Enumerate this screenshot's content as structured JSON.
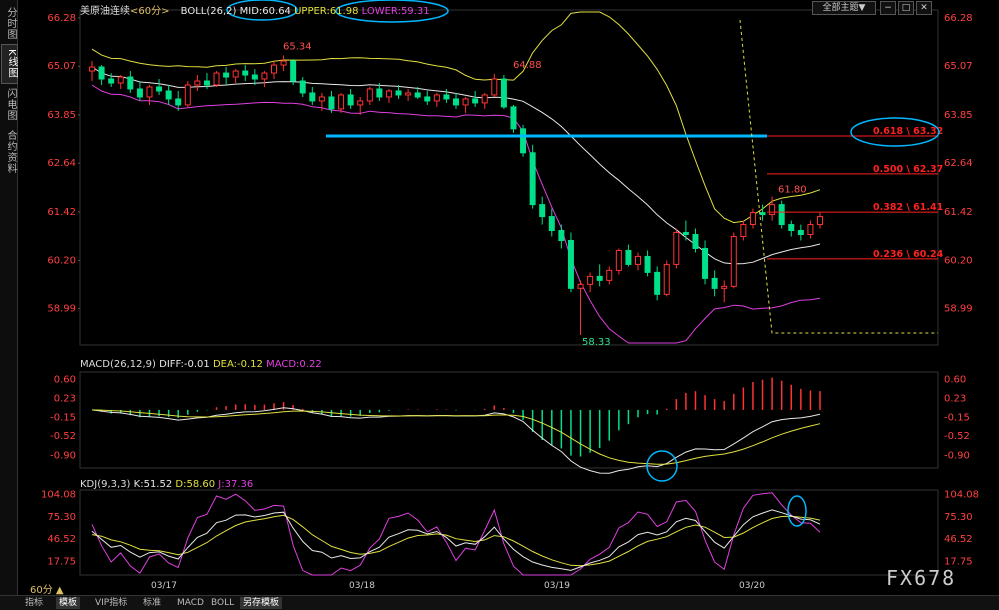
{
  "left_tabs": [
    "分时图",
    "K线图",
    "闪电图",
    "合约资料"
  ],
  "left_tab_active": 1,
  "top_right": {
    "theme_button": "全部主题▼",
    "icons": [
      "−",
      "□",
      "✕"
    ]
  },
  "boll_legend": {
    "symbol": "美原油连续",
    "period": "<60分>",
    "indicator": "BOLL(26,2)",
    "mid": "MID:60.64",
    "upper": "UPPER:61.98",
    "lower": "LOWER:59.31"
  },
  "macd_legend": {
    "name": "MACD(26,12,9)",
    "diff": "DIFF:-0.01",
    "dea": "DEA:-0.12",
    "macd": "MACD:0.22"
  },
  "kdj_legend": {
    "name": "KDJ(9,3,3)",
    "k": "K:51.52",
    "d": "D:58.60",
    "j": "J:37.36"
  },
  "price_axis": [
    "66.28",
    "65.07",
    "63.85",
    "62.64",
    "61.42",
    "60.20",
    "58.99"
  ],
  "macd_axis": [
    "0.60",
    "0.23",
    "-0.15",
    "-0.52",
    "-0.90"
  ],
  "kdj_axis": [
    "104.08",
    "75.30",
    "46.52",
    "17.75"
  ],
  "date_labels": [
    "03/17",
    "03/18",
    "03/19",
    "03/20"
  ],
  "price_annotations": {
    "high1": "65.34",
    "high2": "64.88",
    "low": "58.33",
    "recent_high": "61.80"
  },
  "fib_levels": [
    {
      "label": "0.618 \\ 63.32",
      "value": 63.32
    },
    {
      "label": "0.500 \\ 62.37",
      "value": 62.37
    },
    {
      "label": "0.382 \\ 61.41",
      "value": 61.41
    },
    {
      "label": "0.236 \\ 60.24",
      "value": 60.24
    }
  ],
  "support_line_value": 63.32,
  "period_label": "60分 ▲",
  "bottom_tabs": [
    "指标",
    "模板",
    "VIP指标",
    "标准",
    "MACD",
    "BOLL",
    "另存模板"
  ],
  "bottom_tab_active": [
    1,
    6
  ],
  "watermark": "FX678",
  "colors": {
    "up": "#ff3333",
    "down": "#00e08a",
    "mid": "#e8e8e8",
    "upper": "#e0e040",
    "lower": "#e040e0",
    "fib": "#ff2020",
    "support": "#00b8ff",
    "circle": "#00b8ff"
  },
  "chart_data": {
    "type": "candlestick",
    "candles_ohlc": [
      [
        64.95,
        65.2,
        64.7,
        65.05
      ],
      [
        65.05,
        65.1,
        64.6,
        64.75
      ],
      [
        64.75,
        64.9,
        64.55,
        64.65
      ],
      [
        64.65,
        64.85,
        64.5,
        64.8
      ],
      [
        64.8,
        64.95,
        64.4,
        64.5
      ],
      [
        64.5,
        64.7,
        64.2,
        64.3
      ],
      [
        64.3,
        64.6,
        64.1,
        64.55
      ],
      [
        64.55,
        64.75,
        64.35,
        64.45
      ],
      [
        64.45,
        64.6,
        64.1,
        64.25
      ],
      [
        64.25,
        64.45,
        63.95,
        64.1
      ],
      [
        64.1,
        64.7,
        64.05,
        64.6
      ],
      [
        64.6,
        64.85,
        64.45,
        64.7
      ],
      [
        64.7,
        64.9,
        64.5,
        64.6
      ],
      [
        64.6,
        64.95,
        64.55,
        64.9
      ],
      [
        64.9,
        65.05,
        64.6,
        64.8
      ],
      [
        64.8,
        65.0,
        64.65,
        64.95
      ],
      [
        64.95,
        65.1,
        64.7,
        64.85
      ],
      [
        64.85,
        65.0,
        64.6,
        64.75
      ],
      [
        64.75,
        64.95,
        64.55,
        64.9
      ],
      [
        64.9,
        65.2,
        64.75,
        65.1
      ],
      [
        65.1,
        65.34,
        64.95,
        65.2
      ],
      [
        65.2,
        65.25,
        64.6,
        64.7
      ],
      [
        64.7,
        64.8,
        64.3,
        64.4
      ],
      [
        64.4,
        64.55,
        64.1,
        64.2
      ],
      [
        64.2,
        64.4,
        63.95,
        64.3
      ],
      [
        64.3,
        64.45,
        63.9,
        64.0
      ],
      [
        64.0,
        64.4,
        63.9,
        64.35
      ],
      [
        64.35,
        64.5,
        64.0,
        64.1
      ],
      [
        64.1,
        64.3,
        63.85,
        64.2
      ],
      [
        64.2,
        64.55,
        64.1,
        64.5
      ],
      [
        64.5,
        64.65,
        64.2,
        64.3
      ],
      [
        64.3,
        64.5,
        64.15,
        64.45
      ],
      [
        64.45,
        64.6,
        64.25,
        64.35
      ],
      [
        64.35,
        64.5,
        64.2,
        64.4
      ],
      [
        64.4,
        64.55,
        64.25,
        64.3
      ],
      [
        64.3,
        64.45,
        64.1,
        64.2
      ],
      [
        64.2,
        64.4,
        64.05,
        64.35
      ],
      [
        64.35,
        64.5,
        64.15,
        64.25
      ],
      [
        64.25,
        64.4,
        64.0,
        64.1
      ],
      [
        64.1,
        64.3,
        63.9,
        64.25
      ],
      [
        64.25,
        64.45,
        64.05,
        64.15
      ],
      [
        64.15,
        64.4,
        64.0,
        64.35
      ],
      [
        64.35,
        64.88,
        64.3,
        64.75
      ],
      [
        64.75,
        64.85,
        64.0,
        64.05
      ],
      [
        64.05,
        64.1,
        63.4,
        63.5
      ],
      [
        63.5,
        63.6,
        62.8,
        62.9
      ],
      [
        62.9,
        63.1,
        61.5,
        61.6
      ],
      [
        61.6,
        61.8,
        61.1,
        61.3
      ],
      [
        61.3,
        61.5,
        60.8,
        60.95
      ],
      [
        60.95,
        61.1,
        60.5,
        60.7
      ],
      [
        60.7,
        60.9,
        59.4,
        59.5
      ],
      [
        59.5,
        59.7,
        58.33,
        59.6
      ],
      [
        59.6,
        59.9,
        59.4,
        59.8
      ],
      [
        59.8,
        60.1,
        59.55,
        59.7
      ],
      [
        59.7,
        60.05,
        59.6,
        59.95
      ],
      [
        59.95,
        60.5,
        59.85,
        60.45
      ],
      [
        60.45,
        60.6,
        60.05,
        60.1
      ],
      [
        60.1,
        60.4,
        59.95,
        60.3
      ],
      [
        60.3,
        60.45,
        59.8,
        59.9
      ],
      [
        59.9,
        60.05,
        59.2,
        59.35
      ],
      [
        59.35,
        60.2,
        59.3,
        60.1
      ],
      [
        60.1,
        61.0,
        60.0,
        60.9
      ],
      [
        60.9,
        61.2,
        60.7,
        60.85
      ],
      [
        60.85,
        61.0,
        60.4,
        60.5
      ],
      [
        60.5,
        60.7,
        59.6,
        59.75
      ],
      [
        59.75,
        59.95,
        59.3,
        59.5
      ],
      [
        59.5,
        59.7,
        59.15,
        59.55
      ],
      [
        59.55,
        60.9,
        59.5,
        60.8
      ],
      [
        60.8,
        61.2,
        60.7,
        61.1
      ],
      [
        61.1,
        61.5,
        61.0,
        61.4
      ],
      [
        61.4,
        61.6,
        61.2,
        61.35
      ],
      [
        61.35,
        61.8,
        61.2,
        61.6
      ],
      [
        61.6,
        61.7,
        61.0,
        61.1
      ],
      [
        61.1,
        61.2,
        60.8,
        60.95
      ],
      [
        60.95,
        61.1,
        60.7,
        60.85
      ],
      [
        60.85,
        61.2,
        60.75,
        61.1
      ],
      [
        61.1,
        61.4,
        61.0,
        61.3
      ]
    ],
    "x_labels": [
      "03/17",
      "03/18",
      "03/19",
      "03/20"
    ],
    "y_range": [
      58.33,
      66.28
    ]
  }
}
